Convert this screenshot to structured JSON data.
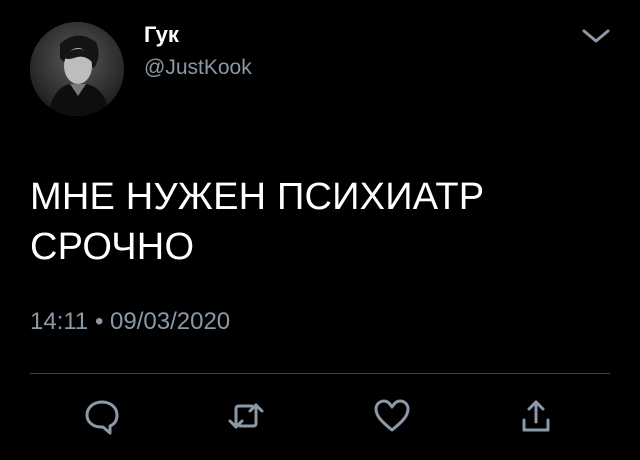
{
  "author": {
    "display_name": "Гук",
    "handle": "@JustKook"
  },
  "tweet": {
    "lines": [
      "МНЕ НУЖЕН ПСИХИАТР",
      "СРОЧНО"
    ],
    "time": "14:11",
    "separator": "•",
    "date": "09/03/2020"
  },
  "icons": {
    "menu": "chevron-down-icon",
    "reply": "reply-icon",
    "retweet": "retweet-icon",
    "like": "heart-icon",
    "share": "share-icon"
  },
  "colors": {
    "background": "#000000",
    "text": "#ffffff",
    "secondary_text": "#8b98a5",
    "icon": "#8b98a5",
    "divider": "#38444d"
  }
}
